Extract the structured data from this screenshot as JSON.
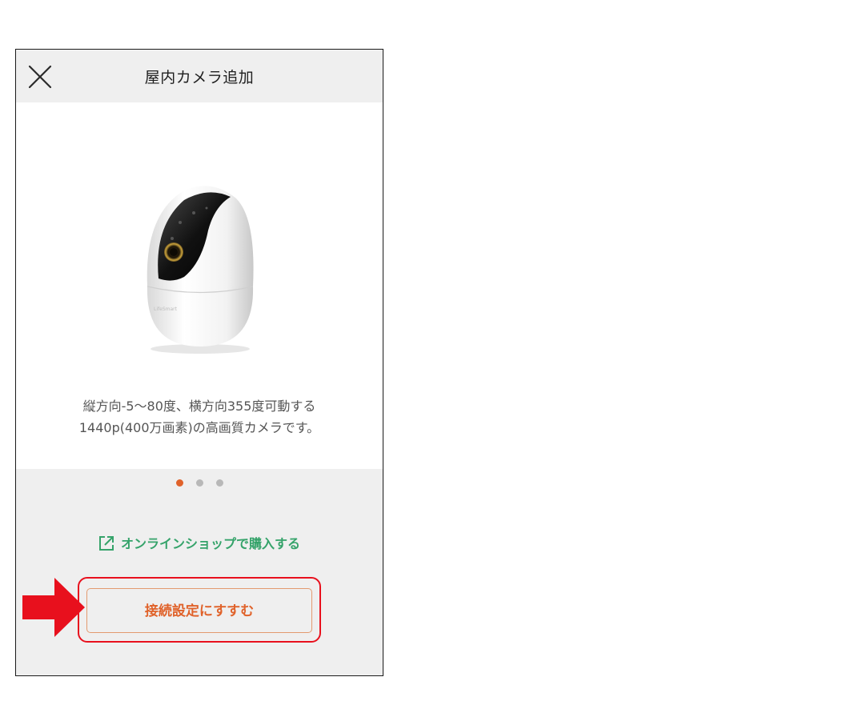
{
  "header": {
    "title": "屋内カメラ追加",
    "close_icon": "close-icon"
  },
  "carousel": {
    "description_line1": "縦方向-5〜80度、横方向355度可動する",
    "description_line2": "1440p(400万画素)の高画質カメラです。",
    "camera_brand": "LifeSmart",
    "page_count": 3,
    "active_page": 1
  },
  "shop_link": {
    "label": "オンラインショップで購入する",
    "icon": "external-link-icon"
  },
  "next_button": {
    "label": "接続設定にすすむ"
  },
  "colors": {
    "accent_orange": "#e0622a",
    "link_green": "#35a36a",
    "annotation_red": "#e8101d"
  }
}
